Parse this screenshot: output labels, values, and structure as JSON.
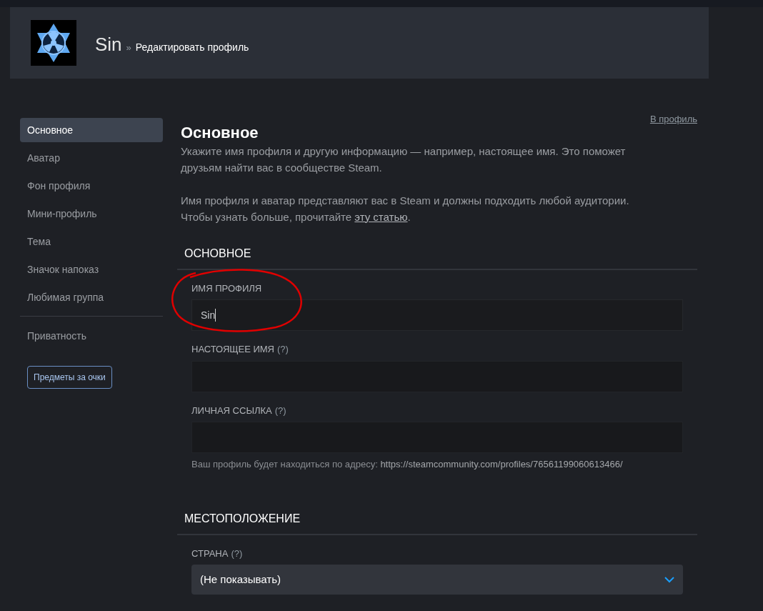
{
  "header": {
    "name": "Sin",
    "separator": "»",
    "subtitle": "Редактировать профиль"
  },
  "sidebar": {
    "items": [
      {
        "label": "Основное",
        "selected": true
      },
      {
        "label": "Аватар",
        "selected": false
      },
      {
        "label": "Фон профиля",
        "selected": false
      },
      {
        "label": "Мини-профиль",
        "selected": false
      },
      {
        "label": "Тема",
        "selected": false
      },
      {
        "label": "Значок напоказ",
        "selected": false
      },
      {
        "label": "Любимая группа",
        "selected": false
      }
    ],
    "privacy": {
      "label": "Приватность",
      "selected": false
    },
    "button": "Предметы за очки"
  },
  "main": {
    "profile_link": "В профиль",
    "title": "Основное",
    "intro": "Укажите имя профиля и другую информацию — например, настоящее имя. Это поможет друзьям найти вас в сообществе Steam.",
    "note": "Имя профиля и аватар представляют вас в Steam и должны подходить любой аудитории. Чтобы узнать больше, прочитайте",
    "note_link": "эту статью",
    "note_end": ".",
    "sections": [
      {
        "heading": "ОСНОВНОЕ",
        "fields": [
          {
            "kind": "text",
            "label": "ИМЯ ПРОФИЛЯ",
            "value": "Sin",
            "focused": true,
            "circled": true
          },
          {
            "kind": "text",
            "label": "НАСТОЯЩЕЕ ИМЯ",
            "help": "(?)",
            "focused": false
          },
          {
            "kind": "text",
            "label": "ЛИЧНАЯ ССЫЛКА",
            "help": "(?)",
            "focused": false,
            "hint": "Ваш профиль будет находиться по адресу:",
            "url": "https://steamcommunity.com/profiles/76561199060613466/"
          }
        ]
      },
      {
        "heading": "МЕСТОПОЛОЖЕНИЕ",
        "fields": [
          {
            "kind": "select",
            "label": "СТРАНА",
            "help": "(?)",
            "value": "(Не показывать)"
          }
        ]
      }
    ]
  }
}
